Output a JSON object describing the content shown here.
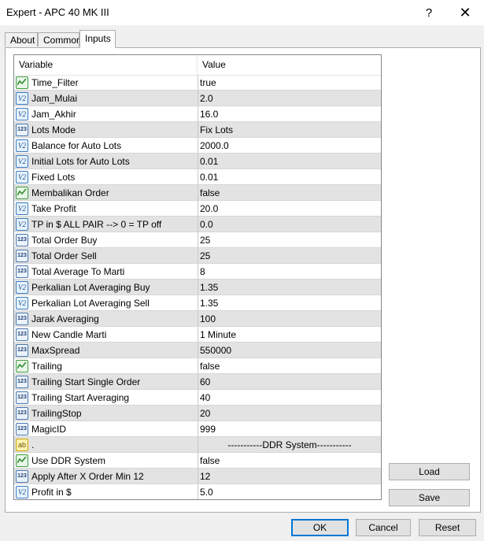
{
  "window": {
    "title": "Expert - APC 40 MK III",
    "help_label": "?",
    "close_label": "✕"
  },
  "tabs": [
    {
      "label": "About",
      "active": false
    },
    {
      "label": "Common",
      "active": false
    },
    {
      "label": "Inputs",
      "active": true
    }
  ],
  "grid": {
    "columns": [
      "Variable",
      "Value"
    ],
    "rows": [
      {
        "name": "Time_Filter",
        "value": "true",
        "type": "bool",
        "icon": "bool-icon"
      },
      {
        "name": "Jam_Mulai",
        "value": "2.0",
        "type": "double",
        "icon": "double-icon"
      },
      {
        "name": "Jam_Akhir",
        "value": "16.0",
        "type": "double",
        "icon": "double-icon"
      },
      {
        "name": "Lots Mode",
        "value": "Fix Lots",
        "type": "int",
        "icon": "int-icon"
      },
      {
        "name": "Balance for Auto Lots",
        "value": "2000.0",
        "type": "double",
        "icon": "double-icon"
      },
      {
        "name": "Initial Lots for Auto Lots",
        "value": "0.01",
        "type": "double",
        "icon": "double-icon"
      },
      {
        "name": "Fixed Lots",
        "value": "0.01",
        "type": "double",
        "icon": "double-icon"
      },
      {
        "name": "Membalikan Order",
        "value": "false",
        "type": "bool",
        "icon": "bool-icon"
      },
      {
        "name": "Take Profit",
        "value": "20.0",
        "type": "double",
        "icon": "double-icon"
      },
      {
        "name": "TP in $ ALL PAIR --> 0 = TP off",
        "value": "0.0",
        "type": "double",
        "icon": "double-icon"
      },
      {
        "name": "Total Order Buy",
        "value": "25",
        "type": "int",
        "icon": "int-icon"
      },
      {
        "name": "Total Order Sell",
        "value": "25",
        "type": "int",
        "icon": "int-icon"
      },
      {
        "name": "Total Average To Marti",
        "value": "8",
        "type": "int",
        "icon": "int-icon"
      },
      {
        "name": "Perkalian Lot Averaging Buy",
        "value": "1.35",
        "type": "double",
        "icon": "double-icon"
      },
      {
        "name": "Perkalian Lot Averaging Sell",
        "value": "1.35",
        "type": "double",
        "icon": "double-icon"
      },
      {
        "name": "Jarak Averaging",
        "value": "100",
        "type": "int",
        "icon": "int-icon"
      },
      {
        "name": "New Candle Marti",
        "value": "1 Minute",
        "type": "int",
        "icon": "int-icon"
      },
      {
        "name": "MaxSpread",
        "value": "550000",
        "type": "int",
        "icon": "int-icon"
      },
      {
        "name": "Trailing",
        "value": "false",
        "type": "bool",
        "icon": "bool-icon"
      },
      {
        "name": "Trailing Start Single Order",
        "value": "60",
        "type": "int",
        "icon": "int-icon"
      },
      {
        "name": "Trailing Start Averaging",
        "value": "40",
        "type": "int",
        "icon": "int-icon"
      },
      {
        "name": "TrailingStop",
        "value": "20",
        "type": "int",
        "icon": "int-icon"
      },
      {
        "name": "MagicID",
        "value": "999",
        "type": "int",
        "icon": "int-icon"
      },
      {
        "name": ".",
        "value": "-----------DDR System-----------",
        "type": "string",
        "icon": "string-icon"
      },
      {
        "name": "Use DDR System",
        "value": "false",
        "type": "bool",
        "icon": "bool-icon"
      },
      {
        "name": "Apply After X Order Min 12",
        "value": "12",
        "type": "int",
        "icon": "int-icon"
      },
      {
        "name": "Profit in $",
        "value": "5.0",
        "type": "double",
        "icon": "double-icon"
      }
    ]
  },
  "icon_glyphs": {
    "double": "V2",
    "int": "123",
    "string": "ab"
  },
  "buttons": {
    "load": "Load",
    "save": "Save",
    "ok": "OK",
    "cancel": "Cancel",
    "reset": "Reset"
  },
  "colors": {
    "accent": "#0078d7",
    "row_alt": "#e3e3e3",
    "bool_icon": "#3d9a3d",
    "double_icon": "#3a7cc0",
    "string_icon": "#c9a400"
  }
}
